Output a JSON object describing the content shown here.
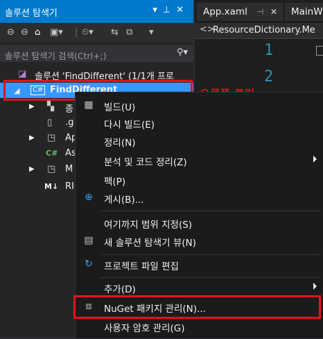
{
  "solution_explorer": {
    "title": "솔루션 탐색기",
    "search_placeholder": "솔루션 탐색기 검색(Ctrl+;)",
    "solution_label": "솔루션 'FindDifferent' (1/1개 프로",
    "project_label": "FindDifferent",
    "tree_items": [
      "종",
      ".g",
      "Ap",
      "As",
      "M",
      "RI"
    ]
  },
  "editor": {
    "tabs": [
      "App.xaml",
      "MainW"
    ],
    "breadcrumb": "ResourceDictionary.Me",
    "line_numbers": [
      "1",
      "2"
    ]
  },
  "annotation": {
    "text": "오른쪽 클릭",
    "color": "#e8111b"
  },
  "context_menu": {
    "items": [
      {
        "label": "빌드(U)",
        "icon": "build-icon"
      },
      {
        "label": "다시 빌드(E)",
        "icon": ""
      },
      {
        "label": "정리(N)",
        "icon": ""
      },
      {
        "label": "분석 및 코드 정리(Z)",
        "icon": "",
        "submenu": true
      },
      {
        "label": "팩(P)",
        "icon": ""
      },
      {
        "label": "게시(B)...",
        "icon": "globe-icon"
      },
      {
        "label": "여기까지 범위 지정(S)",
        "icon": ""
      },
      {
        "label": "새 솔루션 탐색기 뷰(N)",
        "icon": "new-view-icon"
      },
      {
        "label": "프로젝트 파일 편집",
        "icon": "refresh-icon"
      },
      {
        "label": "추가(D)",
        "icon": "",
        "submenu": true
      },
      {
        "label": "NuGet 패키지 관리(N)...",
        "icon": "package-icon"
      },
      {
        "label": "사용자 암호 관리(G)",
        "icon": ""
      }
    ]
  },
  "colors": {
    "accent": "#007acc",
    "selected": "#3399ff",
    "highlight": "#e8111b"
  }
}
